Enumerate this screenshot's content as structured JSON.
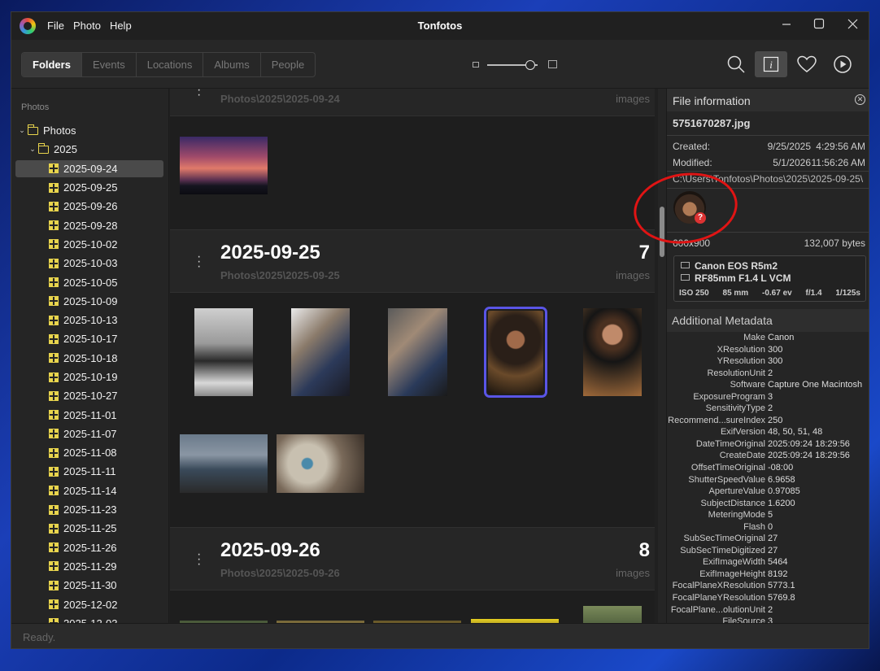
{
  "app": {
    "title": "Tonfotos",
    "menu": [
      "File",
      "Photo",
      "Help"
    ]
  },
  "toolbar": {
    "tabs": [
      "Folders",
      "Events",
      "Locations",
      "Albums",
      "People"
    ],
    "active_tab": "Folders",
    "thumbnail_size_level": 0.85,
    "icons": [
      "search-icon",
      "info-icon",
      "heart-icon",
      "play-icon"
    ]
  },
  "sidebar": {
    "title": "Photos",
    "root": "Photos",
    "year": "2025",
    "folders": [
      "2025-09-24",
      "2025-09-25",
      "2025-09-26",
      "2025-09-28",
      "2025-10-02",
      "2025-10-03",
      "2025-10-05",
      "2025-10-09",
      "2025-10-13",
      "2025-10-17",
      "2025-10-18",
      "2025-10-19",
      "2025-10-27",
      "2025-11-01",
      "2025-11-07",
      "2025-11-08",
      "2025-11-11",
      "2025-11-14",
      "2025-11-23",
      "2025-11-25",
      "2025-11-26",
      "2025-11-29",
      "2025-11-30",
      "2025-12-02",
      "2025-12-03"
    ],
    "selected": "2025-09-24"
  },
  "groups": [
    {
      "title": "",
      "path": "Photos\\2025\\2025-09-24",
      "count": "",
      "unit": "images"
    },
    {
      "title": "2025-09-25",
      "path": "Photos\\2025\\2025-09-25",
      "count": "7",
      "unit": "images"
    },
    {
      "title": "2025-09-26",
      "path": "Photos\\2025\\2025-09-26",
      "count": "8",
      "unit": "images"
    }
  ],
  "file_info": {
    "header": "File information",
    "filename": "5751670287.jpg",
    "created_label": "Created:",
    "created_date": "9/25/2025",
    "created_time": "4:29:56 AM",
    "modified_label": "Modified:",
    "modified_date": "5/1/2026",
    "modified_time": "11:56:26 AM",
    "path": "C:\\Users\\Tonfotos\\Photos\\2025\\2025-09-25\\",
    "unknown_face_badge": "?",
    "dimensions": "600x900",
    "size": "132,007 bytes",
    "camera": "Canon EOS R5m2",
    "lens": "RF85mm F1.4 L VCM",
    "iso": "ISO 250",
    "focal": "85 mm",
    "ev": "-0.67 ev",
    "aperture": "f/1.4",
    "shutter": "1/125s"
  },
  "metadata": {
    "header": "Additional Metadata",
    "rows": [
      [
        "Make",
        "Canon"
      ],
      [
        "XResolution",
        "300"
      ],
      [
        "YResolution",
        "300"
      ],
      [
        "ResolutionUnit",
        "2"
      ],
      [
        "Software",
        "Capture One Macintosh"
      ],
      [
        "ExposureProgram",
        "3"
      ],
      [
        "SensitivityType",
        "2"
      ],
      [
        "Recommend...sureIndex",
        "250"
      ],
      [
        "ExifVersion",
        "48, 50, 51, 48"
      ],
      [
        "DateTimeOriginal",
        "2025:09:24 18:29:56"
      ],
      [
        "CreateDate",
        "2025:09:24 18:29:56"
      ],
      [
        "OffsetTimeOriginal",
        "-08:00"
      ],
      [
        "ShutterSpeedValue",
        "6.9658"
      ],
      [
        "ApertureValue",
        "0.97085"
      ],
      [
        "SubjectDistance",
        "1.6200"
      ],
      [
        "MeteringMode",
        "5"
      ],
      [
        "Flash",
        "0"
      ],
      [
        "SubSecTimeOriginal",
        "27"
      ],
      [
        "SubSecTimeDigitized",
        "27"
      ],
      [
        "ExifImageWidth",
        "5464"
      ],
      [
        "ExifImageHeight",
        "8192"
      ],
      [
        "FocalPlaneXResolution",
        "5773.1"
      ],
      [
        "FocalPlaneYResolution",
        "5769.8"
      ],
      [
        "FocalPlane...olutionUnit",
        "2"
      ],
      [
        "FileSource",
        "3"
      ]
    ]
  },
  "status": "Ready."
}
